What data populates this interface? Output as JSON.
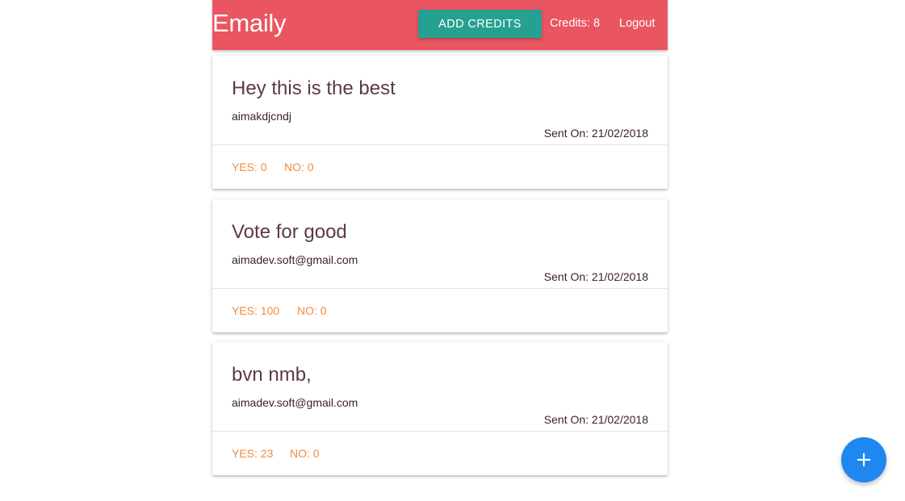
{
  "navbar": {
    "brand": "Emaily",
    "add_credits_label": "ADD CREDITS",
    "credits_label": "Credits: 8",
    "logout_label": "Logout",
    "bg_color": "#e95561",
    "button_color": "#26a191"
  },
  "surveys": [
    {
      "title": "Hey this is the best",
      "email": "aimakdjcndj",
      "sent_on": "Sent On: 21/02/2018",
      "yes": "YES: 0",
      "no": "NO: 0"
    },
    {
      "title": "Vote for good",
      "email": "aimadev.soft@gmail.com",
      "sent_on": "Sent On: 21/02/2018",
      "yes": "YES: 100",
      "no": "NO: 0"
    },
    {
      "title": "bvn nmb,",
      "email": "aimadev.soft@gmail.com",
      "sent_on": "Sent On: 21/02/2018",
      "yes": "YES: 23",
      "no": "NO: 0"
    }
  ],
  "fab": {
    "icon": "add-icon",
    "glyph": "+",
    "color": "#1e87f0"
  },
  "accent_color": "#f08c3f"
}
